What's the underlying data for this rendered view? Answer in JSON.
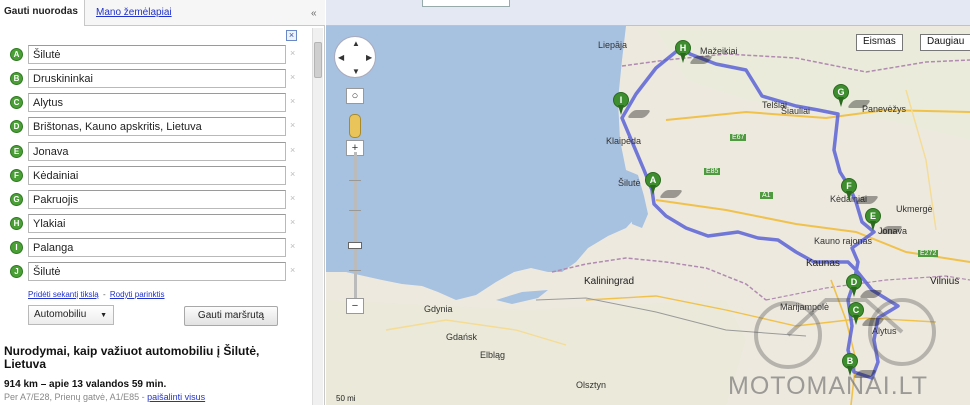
{
  "sidebar": {
    "tab_directions": "Gauti nuorodas",
    "tab_my_maps": "Mano žemėlapiai",
    "collapse_glyph": "«",
    "close_glyph": "×",
    "waypoints": [
      {
        "letter": "A",
        "value": "Šilutė"
      },
      {
        "letter": "B",
        "value": "Druskininkai"
      },
      {
        "letter": "C",
        "value": "Alytus"
      },
      {
        "letter": "D",
        "value": "Brištonas, Kauno apskritis, Lietuva"
      },
      {
        "letter": "E",
        "value": "Jonava"
      },
      {
        "letter": "F",
        "value": "Kėdainiai"
      },
      {
        "letter": "G",
        "value": "Pakruojis"
      },
      {
        "letter": "H",
        "value": "Ylakiai"
      },
      {
        "letter": "I",
        "value": "Palanga"
      },
      {
        "letter": "J",
        "value": "Šilutė"
      }
    ],
    "link_add_destination": "Pridėti sekantį tikslą",
    "link_separator": "-",
    "link_show_options": "Rodyti parinktis",
    "mode_value": "Automobiliu",
    "get_directions_button": "Gauti maršrutą",
    "result": {
      "title": "Nurodymai, kaip važiuot automobiliu į Šilutė, Lietuva",
      "distance": "914 km",
      "duration_text": " – apie 13 valandos 59 min.",
      "via_text": "Per A7/E28, Prienų gatvė, A1/E85 - ",
      "via_link": "paišalinti visus"
    }
  },
  "map": {
    "button_traffic": "Eismas",
    "button_more": "Daugiau",
    "zoom_in": "+",
    "zoom_out": "−",
    "scale_text": "50 mi",
    "watermark": "MOTOMANAI.LT",
    "colors": {
      "sea": "#a7c1e0",
      "land": "#ede9df",
      "route": "#5b63d6",
      "marker": "#3e8e2f",
      "panel_bar": "#e3e8f2"
    },
    "markers": [
      {
        "letter": "H"
      },
      {
        "letter": "I"
      },
      {
        "letter": "G"
      },
      {
        "letter": "A"
      },
      {
        "letter": "F"
      },
      {
        "letter": "E"
      },
      {
        "letter": "D"
      },
      {
        "letter": "C"
      },
      {
        "letter": "B"
      }
    ],
    "place_labels": {
      "liepaja": "Liepāja",
      "mazeikiai": "Mažeikiai",
      "klaipeda": "Klaipėda",
      "panevezys": "Panevėžys",
      "kedainiai": "Kėdainiai",
      "jonava": "Jonava",
      "kaunas": "Kaunas",
      "kauno_rajonas": "Kauno rajonas",
      "vilnius": "Vilnius",
      "kaliningrad": "Kaliningrad",
      "gdansk": "Gdańsk",
      "gdynia": "Gdynia",
      "elblag": "Elbląg",
      "olsztyn": "Olsztyn",
      "alytus": "Alytus",
      "siauliai": "Šiauliai",
      "ukmerge": "Ukmergė",
      "telsiai": "Telšiai",
      "silute": "Šilutė",
      "marijampole": "Marijampolė"
    },
    "road_labels": {
      "e85": "E85",
      "e272": "E272",
      "e67": "E67",
      "a1": "A1"
    }
  }
}
